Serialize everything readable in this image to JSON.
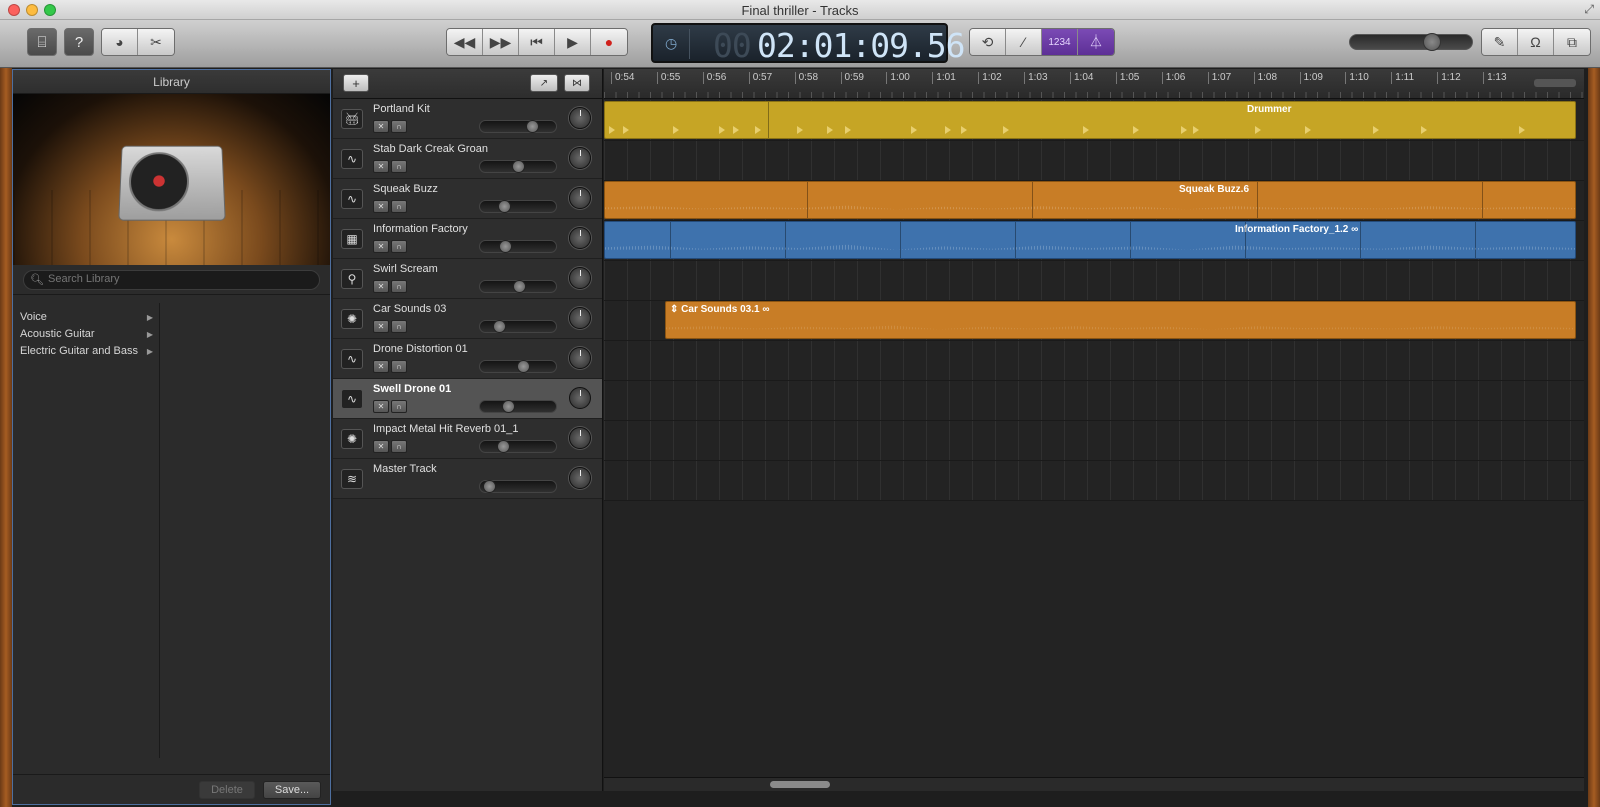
{
  "window": {
    "title": "Final thriller - Tracks"
  },
  "toolbar": {
    "lcd_hours": "00",
    "lcd_time": "02:01:09.56",
    "lcd_mode_icon": "clock-icon",
    "count_in_label": "1234",
    "master_volume": 0.7
  },
  "library": {
    "header": "Library",
    "search_placeholder": "Search Library",
    "categories": [
      "Voice",
      "Acoustic Guitar",
      "Electric Guitar and Bass"
    ],
    "delete_label": "Delete",
    "save_label": "Save..."
  },
  "tracks": [
    {
      "name": "Portland Kit",
      "icon": "drum-kit-icon",
      "volume": 0.72,
      "selected": false
    },
    {
      "name": "Stab Dark Creak Groan",
      "icon": "waveform-icon",
      "volume": 0.5,
      "selected": false
    },
    {
      "name": "Squeak Buzz",
      "icon": "waveform-icon",
      "volume": 0.28,
      "selected": false
    },
    {
      "name": "Information Factory",
      "icon": "drum-machine-icon",
      "volume": 0.3,
      "selected": false
    },
    {
      "name": "Swirl Scream",
      "icon": "microphone-icon",
      "volume": 0.52,
      "selected": false
    },
    {
      "name": "Car Sounds 03",
      "icon": "sparkle-icon",
      "volume": 0.2,
      "selected": false
    },
    {
      "name": "Drone Distortion 01",
      "icon": "waveform-icon",
      "volume": 0.58,
      "selected": false
    },
    {
      "name": "Swell Drone 01",
      "icon": "waveform-icon",
      "volume": 0.34,
      "selected": true
    },
    {
      "name": "Impact Metal Hit Reverb 01_1",
      "icon": "sparkle-icon",
      "volume": 0.26,
      "selected": false
    },
    {
      "name": "Master Track",
      "icon": "master-icon",
      "volume": 0.04,
      "selected": false
    }
  ],
  "ruler": {
    "ticks": [
      "0:54",
      "0:55",
      "0:56",
      "0:57",
      "0:58",
      "0:59",
      "1:00",
      "1:01",
      "1:02",
      "1:03",
      "1:04",
      "1:05",
      "1:06",
      "1:07",
      "1:08",
      "1:09",
      "1:10",
      "1:11",
      "1:12",
      "1:13"
    ]
  },
  "regions": {
    "drummer": "Drummer",
    "squeak": "Squeak Buzz.6",
    "info": "Information Factory_1.2",
    "car": "Car Sounds 03.1"
  },
  "colors": {
    "drummer": "#c6a525",
    "audio_orange": "#c87d26",
    "loop_blue": "#3e72ad",
    "count_in_purple": "#6b3fa6"
  }
}
